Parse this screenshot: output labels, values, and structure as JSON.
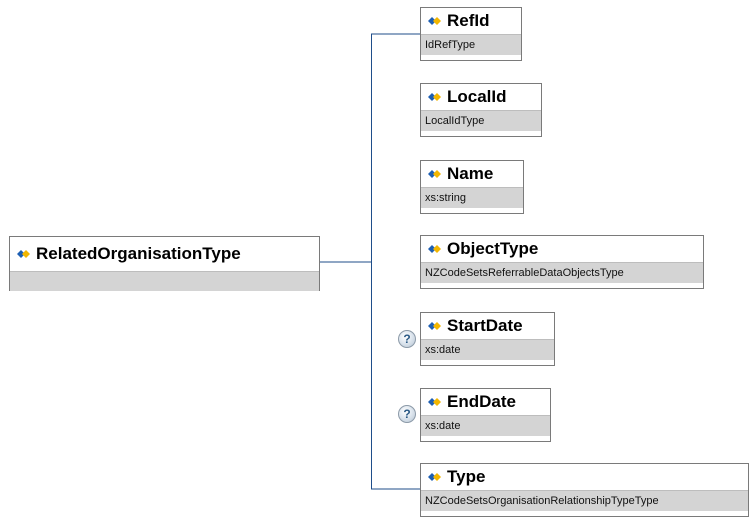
{
  "root": {
    "name": "RelatedOrganisationType",
    "type": ""
  },
  "children": [
    {
      "name": "RefId",
      "type": "IdRefType",
      "optional": false
    },
    {
      "name": "LocalId",
      "type": "LocalIdType",
      "optional": false
    },
    {
      "name": "Name",
      "type": "xs:string",
      "optional": false
    },
    {
      "name": "ObjectType",
      "type": "NZCodeSetsReferrableDataObjectsType",
      "optional": false
    },
    {
      "name": "StartDate",
      "type": "xs:date",
      "optional": true
    },
    {
      "name": "EndDate",
      "type": "xs:date",
      "optional": true
    },
    {
      "name": "Type",
      "type": "NZCodeSetsOrganisationRelationshipTypeType",
      "optional": false
    }
  ],
  "optional_marker": "?",
  "colors": {
    "line": "#1f4e8a",
    "type_bar": "#d4d4d4",
    "border": "#7a7a7a",
    "icon_blue": "#1d5fb3",
    "icon_yellow": "#f2b600"
  }
}
